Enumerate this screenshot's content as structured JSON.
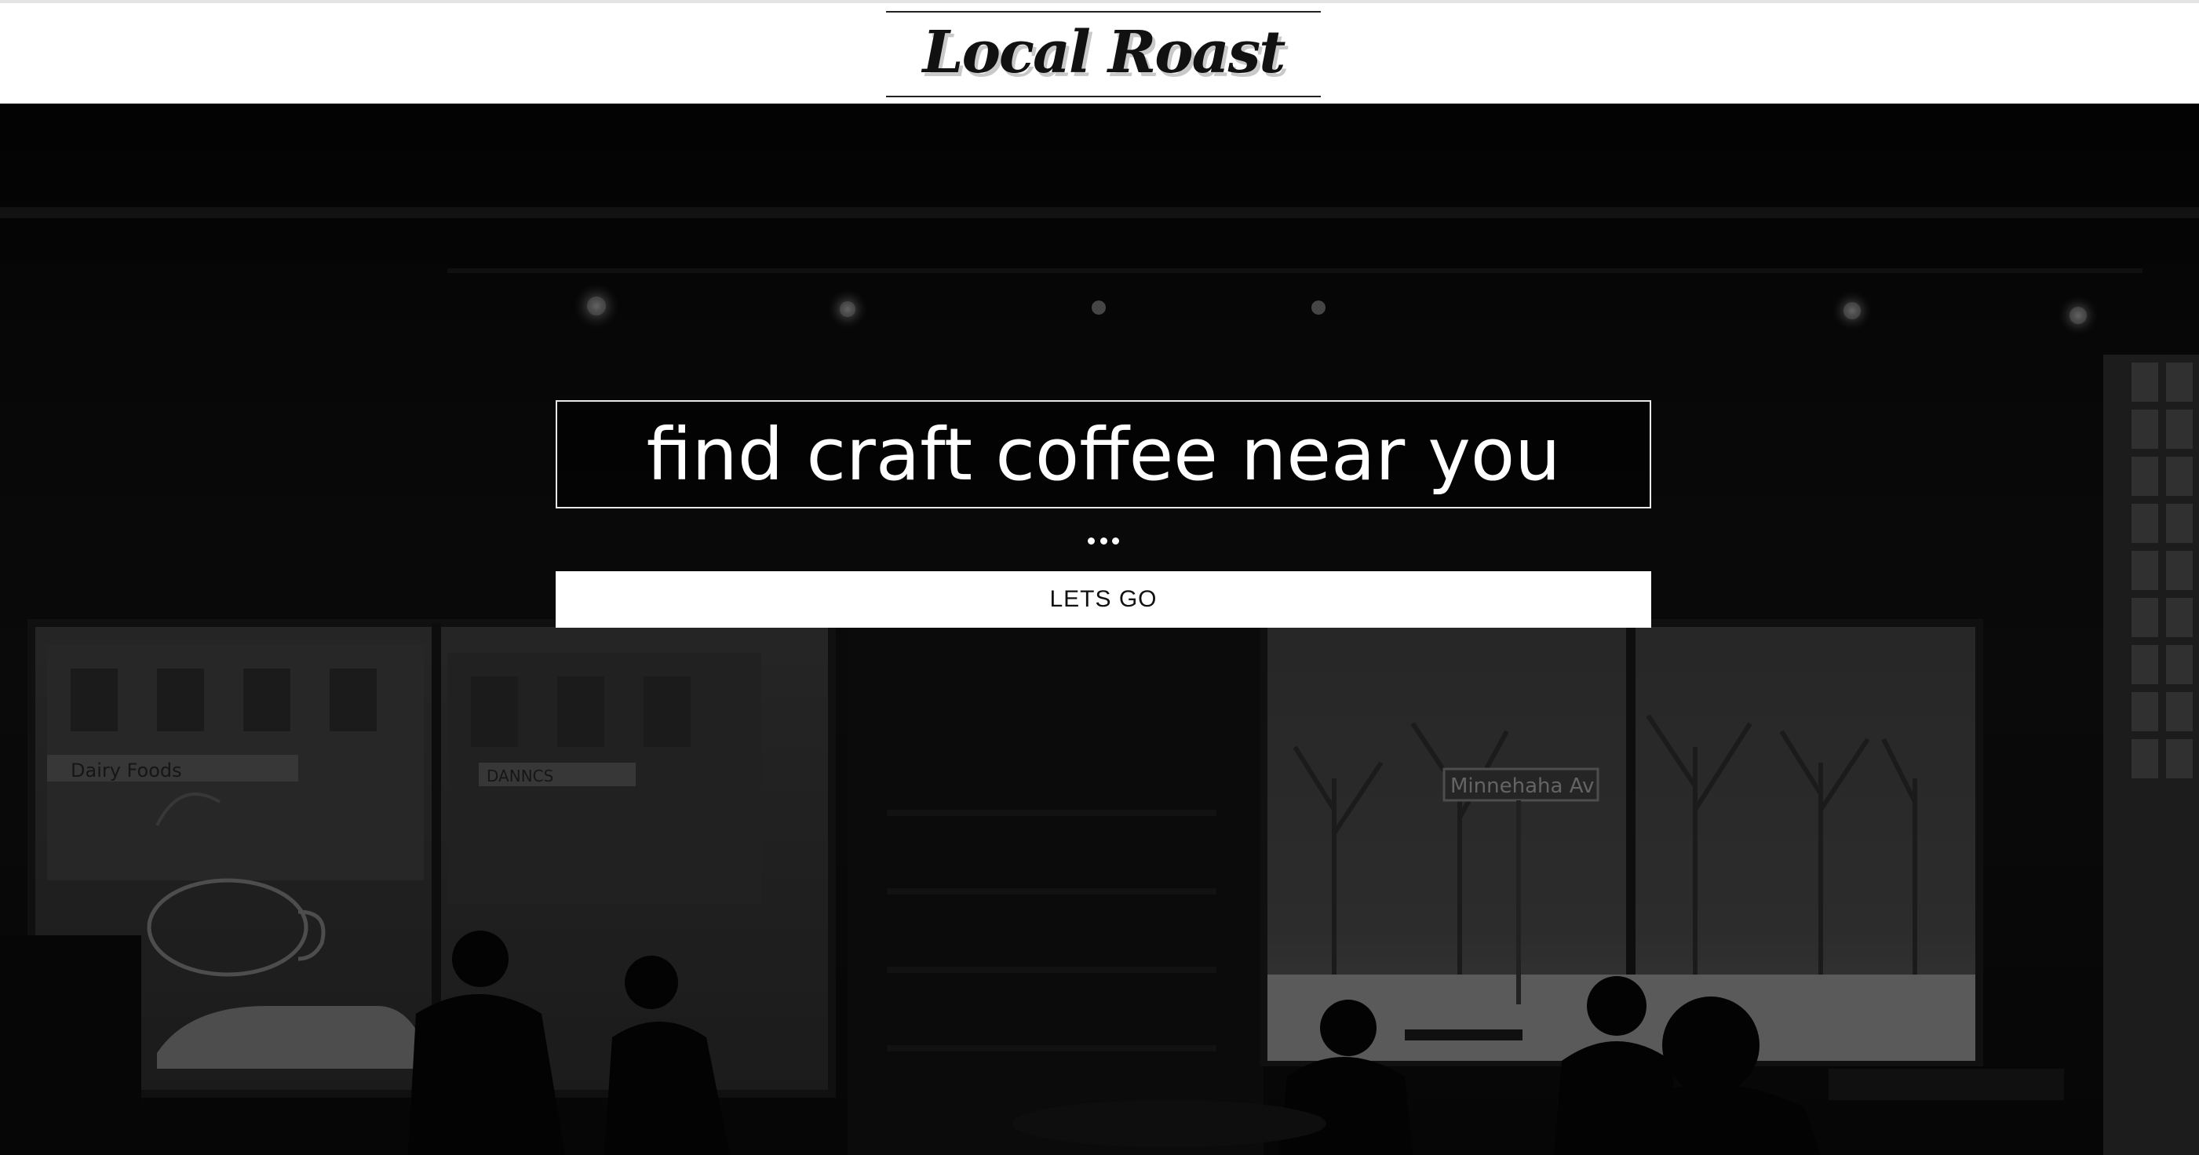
{
  "header": {
    "logo_text": "Local Roast"
  },
  "hero": {
    "background": "coffee-shop-photo",
    "search": {
      "placeholder": "find craft coffee near you"
    },
    "button_label": "LETS GO",
    "signs": {
      "street_sign": "Minnehaha Av",
      "store_sign_left": "Dairy Foods",
      "store_sign_right": "DANNCS"
    }
  },
  "colors": {
    "header_bg": "#ffffff",
    "hero_overlay": "#000000",
    "accent": "#ffffff"
  }
}
